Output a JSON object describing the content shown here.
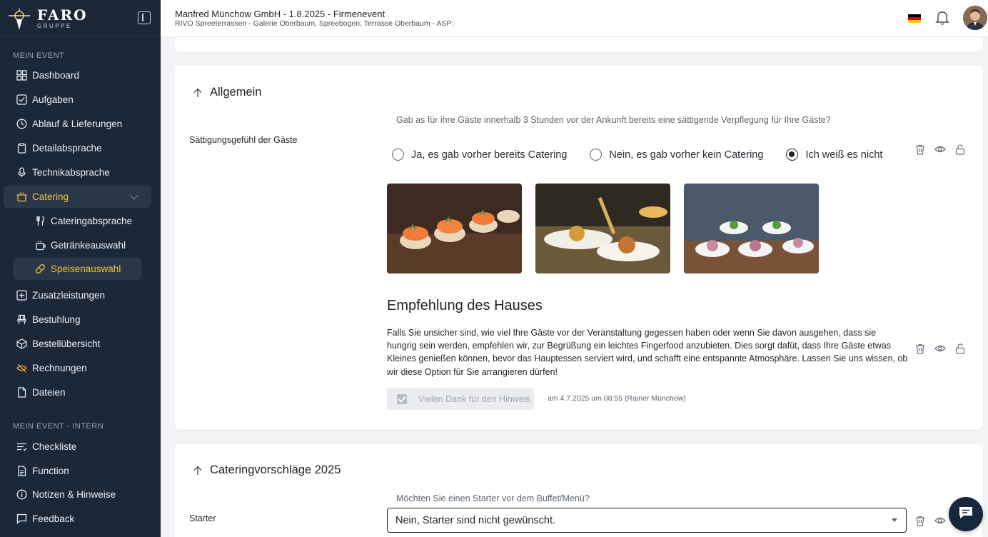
{
  "brand": {
    "name": "FARO",
    "sub": "GRUPPE"
  },
  "sidebar": {
    "section1": "MEIN EVENT",
    "items": [
      {
        "label": "Dashboard",
        "icon": "grid-icon"
      },
      {
        "label": "Aufgaben",
        "icon": "checkbox-icon"
      },
      {
        "label": "Ablauf & Lieferungen",
        "icon": "clock-icon"
      },
      {
        "label": "Detailabsprache",
        "icon": "clipboard-icon"
      },
      {
        "label": "Technikabsprache",
        "icon": "microphone-icon"
      },
      {
        "label": "Catering",
        "icon": "pot-icon"
      }
    ],
    "sub_items": [
      {
        "label": "Cateringabsprache",
        "icon": "fork-knife-icon"
      },
      {
        "label": "Getränkeauswahl",
        "icon": "cup-icon"
      },
      {
        "label": "Speisenauswahl",
        "icon": "pill-icon"
      }
    ],
    "items2": [
      {
        "label": "Zusatzleistungen",
        "icon": "plus-square-icon"
      },
      {
        "label": "Bestuhlung",
        "icon": "chair-icon"
      },
      {
        "label": "Bestellübersicht",
        "icon": "box-icon"
      },
      {
        "label": "Rechnungen",
        "icon": "hidden-icon"
      },
      {
        "label": "Dateien",
        "icon": "file-icon"
      }
    ],
    "section2": "MEIN EVENT - INTERN",
    "items3": [
      {
        "label": "Checkliste",
        "icon": "list-icon"
      },
      {
        "label": "Function",
        "icon": "document-icon"
      },
      {
        "label": "Notizen & Hinweise",
        "icon": "info-icon"
      },
      {
        "label": "Feedback",
        "icon": "message-icon"
      }
    ]
  },
  "header": {
    "title": "Manfred Münchow GmbH - 1.8.2025 - Firmenevent",
    "subtitle": "RIVO Spreeterrassen - Galerie Oberbaum, Spreebogen, Terrasse Oberbaum - ASP:"
  },
  "section_allgemein": {
    "title": "Allgemein",
    "question": "Gab as für ihre Gäste innerhalb 3 Stunden vor der Ankunft bereits eine sättigende Verpflegung für Ihre Gäste?",
    "field_label": "Sättigungsgefühl der Gäste",
    "options": [
      "Ja, es gab vorher bereits Catering",
      "Nein, es gab vorher kein Catering",
      "Ich weiß es nicht"
    ],
    "selected_index": 2,
    "reco_title": "Empfehlung des Hauses",
    "reco_text": "Falls Sie unsicher sind, wie viel Ihre Gäste vor der Veranstaltung gegessen haben oder wenn Sie davon ausgehen, dass sie hungrig sein werden, empfehlen wir, zur Begrüßung ein leichtes Fingerfood anzubieten. Dies sorgt dafüt, dass Ihre Gäste etwas Kleines genießen können, bevor das Hauptessen serviert wird, und schafft eine entspannte Atmosphäre. Lassen Sie uns wissen, ob wir diese Option für Sie arrangieren dürfen!",
    "ack_label": "Vielen Dank für den Hinweis",
    "ack_meta": "am 4.7.2025 um 08:55 (Rainer Münchow)"
  },
  "section_catering": {
    "title": "Cateringvorschläge 2025",
    "question": "Möchten Sie einen Starter vor dem Buffet/Menü?",
    "field_label": "Starter",
    "select_value": "Nein, Starter sind nicht gewünscht."
  },
  "colors": {
    "sidebar": "#1c2838",
    "accent": "#f2c23b"
  }
}
